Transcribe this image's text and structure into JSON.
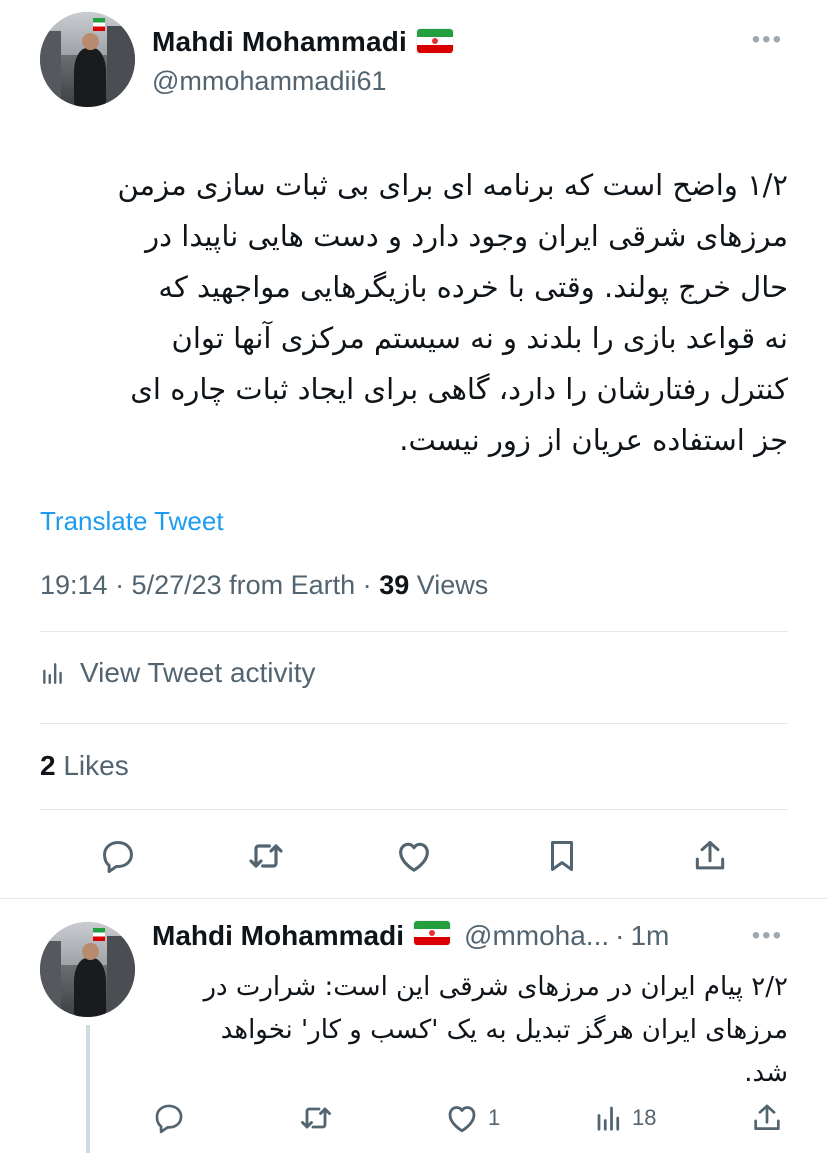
{
  "main_tweet": {
    "author_name": "Mahdi Mohammadi",
    "author_handle": "@mmohammadii61",
    "flag_emoji": "iran-flag",
    "more_icon": "ellipsis-icon",
    "text_lines": "۱/۲ واضح است که برنامه ای برای بی ثبات سازی مزمن\nمرزهای شرقی ایران وجود دارد و دست هایی ناپیدا در\nحال خرج پولند. وقتی با خرده بازیگرهایی مواجهید که\nنه قواعد بازی را بلدند و نه سیستم مرکزی آنها توان\nکنترل رفتارشان را دارد، گاهی برای ایجاد ثبات چاره ای\nجز استفاده عریان از زور نیست.",
    "translate_label": "Translate Tweet",
    "time": "19:14 · 5/27/23 from Earth · ",
    "views_count": "39",
    "views_label": " Views",
    "activity_label": "View Tweet activity",
    "likes_count": "2",
    "likes_label": " Likes",
    "actions": [
      "reply-icon",
      "retweet-icon",
      "like-icon",
      "bookmark-icon",
      "share-icon"
    ]
  },
  "reply_tweet": {
    "author_name": "Mahdi Mohammadi",
    "author_handle": "@mmoha...",
    "dot": "·",
    "time": "1m",
    "text_lines": "۲/۲ پیام ایران در مرزهای شرقی این است: شرارت در\nمرزهای ایران هرگز تبدیل به یک 'کسب و کار' نخواهد\nشد.",
    "like_count": "1",
    "views_count": "18"
  },
  "colors": {
    "text": "#0f1419",
    "secondary": "#536471",
    "link": "#1d9bf0",
    "divider": "#e3e7ea"
  }
}
